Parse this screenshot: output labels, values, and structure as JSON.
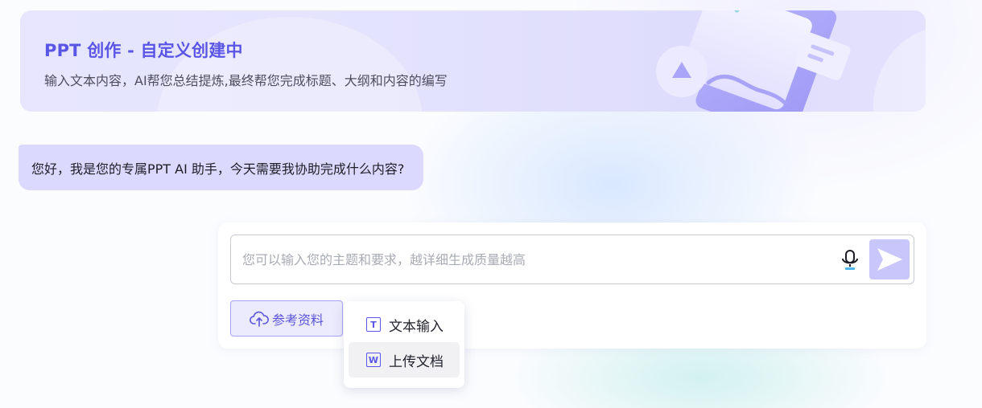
{
  "banner": {
    "title": "PPT 创作 - 自定义创建中",
    "subtitle": "输入文本内容，AI帮您总结提炼,最终帮您完成标题、大纲和内容的编写"
  },
  "chat": {
    "greeting": "您好，我是您的专属PPT AI 助手，今天需要我协助完成什么内容?"
  },
  "composer": {
    "input_value": "",
    "input_placeholder": "您可以输入您的主题和要求，越详细生成质量越高",
    "mic_icon": "microphone-icon",
    "send_icon": "send-icon",
    "reference_label": "参考资料",
    "reference_icon": "cloud-upload-icon"
  },
  "dropdown": {
    "items": [
      {
        "label": "文本输入",
        "icon": "text-icon",
        "icon_glyph": "T"
      },
      {
        "label": "上传文档",
        "icon": "word-doc-icon",
        "icon_glyph": "W"
      }
    ],
    "hovered_index": 1
  },
  "colors": {
    "accent": "#5b55e6",
    "banner_bg": "#e4e3fd",
    "bubble_bg": "#dbd9fd",
    "send_bg": "#c9c6fb"
  }
}
